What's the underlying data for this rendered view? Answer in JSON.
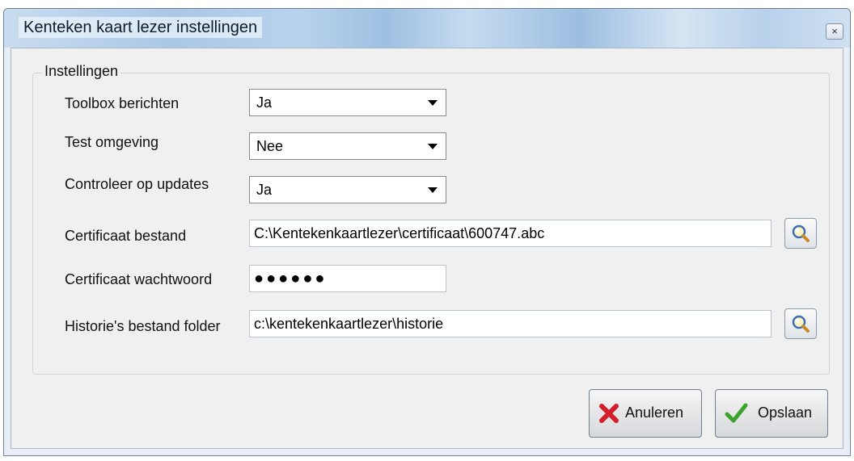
{
  "window": {
    "title": "Kenteken kaart lezer instellingen",
    "close_glyph": "×"
  },
  "group": {
    "label": "Instellingen"
  },
  "settings": {
    "toolbox": {
      "label": "Toolbox berichten",
      "value": "Ja"
    },
    "test_env": {
      "label": "Test omgeving",
      "value": "Nee"
    },
    "updates": {
      "label": "Controleer op updates",
      "value": "Ja"
    },
    "cert_file": {
      "label": "Certificaat bestand",
      "value": "C:\\Kentekenkaartlezer\\certificaat\\600747.abc"
    },
    "cert_password": {
      "label": "Certificaat wachtwoord",
      "value": "●●●●●●"
    },
    "history_folder": {
      "label": "Historie's bestand folder",
      "value": "c:\\kentekenkaartlezer\\historie"
    }
  },
  "buttons": {
    "cancel": "Anuleren",
    "save": "Opslaan"
  },
  "icons": {
    "browse": "magnifier-icon",
    "cancel": "red-x-icon",
    "save": "green-check-icon"
  }
}
